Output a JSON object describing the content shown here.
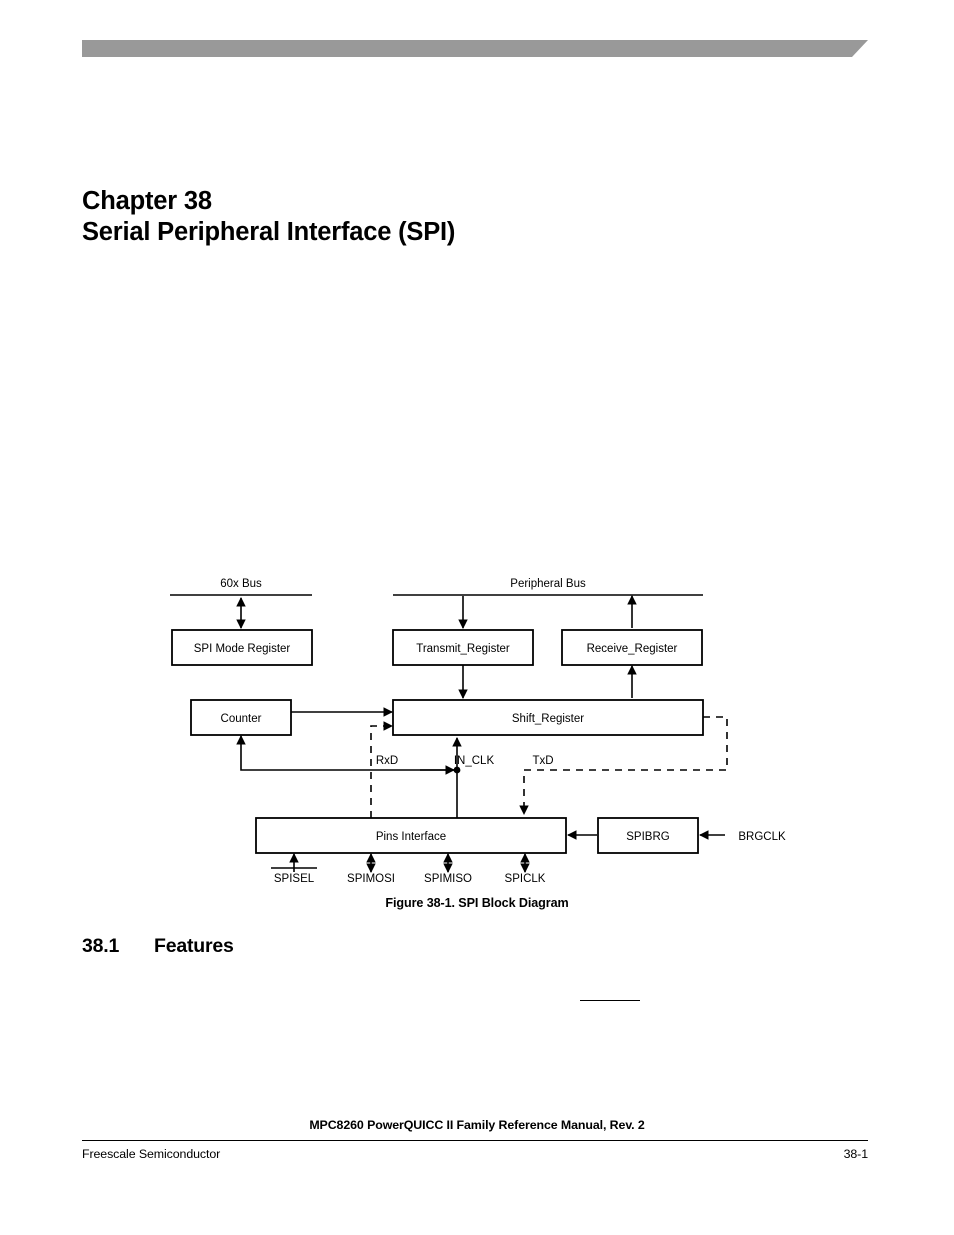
{
  "page": {
    "banner_color": "#999999",
    "background_color": "#ffffff",
    "ink_color": "#000000"
  },
  "chapter": {
    "number": "Chapter 38",
    "title": "Serial Peripheral Interface (SPI)"
  },
  "figure": {
    "caption": "Figure 38-1. SPI Block Diagram",
    "buses": [
      {
        "id": "bus-60x",
        "label": "60x Bus"
      },
      {
        "id": "bus-peripheral",
        "label": "Peripheral Bus"
      }
    ],
    "blocks": [
      {
        "id": "spi-mode-register",
        "label": "SPI Mode Register"
      },
      {
        "id": "transmit-register",
        "label": "Transmit_Register"
      },
      {
        "id": "receive-register",
        "label": "Receive_Register"
      },
      {
        "id": "counter",
        "label": "Counter"
      },
      {
        "id": "shift-register",
        "label": "Shift_Register"
      },
      {
        "id": "pins-interface",
        "label": "Pins Interface"
      },
      {
        "id": "spibrg",
        "label": "SPIBRG"
      }
    ],
    "internal_signals": [
      {
        "id": "rxd",
        "label": "RxD",
        "style": "dashed"
      },
      {
        "id": "in-clk",
        "label": "IN_CLK",
        "style": "solid"
      },
      {
        "id": "txd",
        "label": "TxD",
        "style": "dashed"
      }
    ],
    "external_signals": [
      {
        "id": "brgclk",
        "label": "BRGCLK",
        "active_low": false
      }
    ],
    "pins": [
      {
        "id": "spisel",
        "label": "SPISEL",
        "active_low": true
      },
      {
        "id": "spimosi",
        "label": "SPIMOSI",
        "active_low": false
      },
      {
        "id": "spimiso",
        "label": "SPIMISO",
        "active_low": false
      },
      {
        "id": "spiclk",
        "label": "SPICLK",
        "active_low": false
      }
    ]
  },
  "section": {
    "number": "38.1",
    "title": "Features"
  },
  "footer": {
    "manual": "MPC8260 PowerQUICC II Family Reference Manual, Rev. 2",
    "company": "Freescale Semiconductor",
    "page_number": "38-1"
  }
}
